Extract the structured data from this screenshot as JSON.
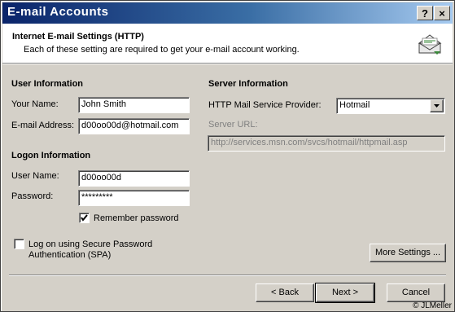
{
  "window": {
    "title": "E-mail Accounts",
    "help_label": "?",
    "close_label": "×"
  },
  "header": {
    "title": "Internet E-mail Settings (HTTP)",
    "subtitle": "Each of these setting are required to get your e-mail account working.",
    "icon": "envelope-icon"
  },
  "user_info": {
    "heading": "User Information",
    "name_label": "Your Name:",
    "name_value": "John Smith",
    "email_label": "E-mail Address:",
    "email_value": "d00oo00d@hotmail.com"
  },
  "logon_info": {
    "heading": "Logon Information",
    "username_label": "User Name:",
    "username_value": "d00oo00d",
    "password_label": "Password:",
    "password_value": "*********",
    "remember_label": "Remember password",
    "remember_checked": true
  },
  "server_info": {
    "heading": "Server Information",
    "provider_label": "HTTP Mail Service Provider:",
    "provider_value": "Hotmail",
    "url_label": "Server URL:",
    "url_value": "http://services.msn.com/svcs/hotmail/httpmail.asp"
  },
  "spa": {
    "label": "Log on using Secure Password Authentication (SPA)",
    "checked": false
  },
  "buttons": {
    "more_settings": "More Settings ...",
    "back": "< Back",
    "next": "Next >",
    "cancel": "Cancel"
  },
  "footer": {
    "copyright": "© JLMeller"
  }
}
